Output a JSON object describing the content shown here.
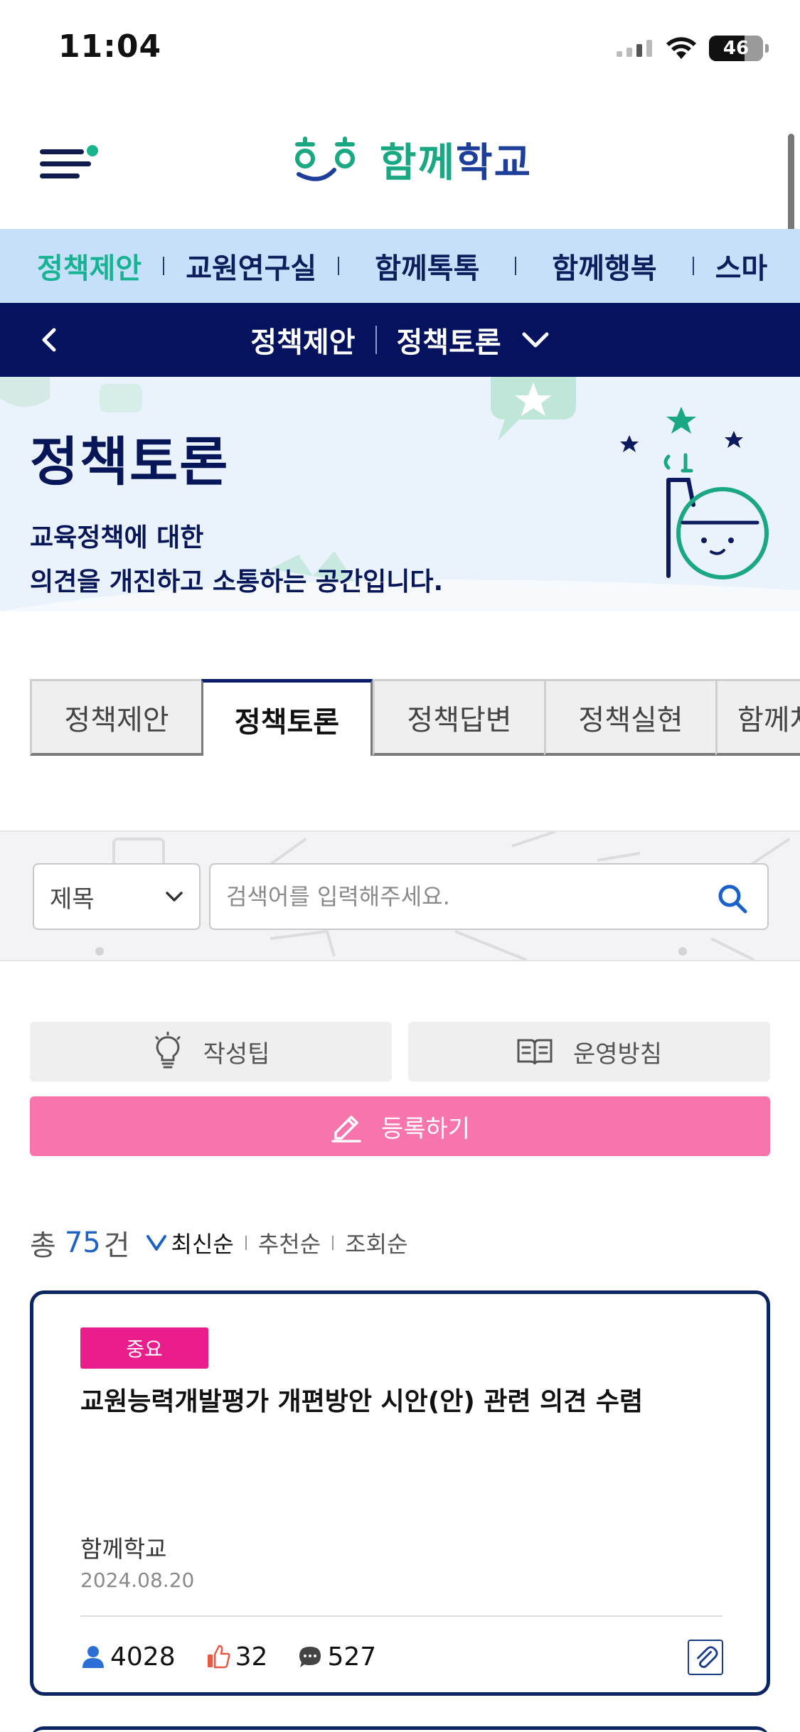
{
  "status_bar": {
    "time": "11:04",
    "battery": "46"
  },
  "header": {
    "logo_text_green": "함께",
    "logo_text_blue": "학교",
    "colors": {
      "navy": "#05135f",
      "green": "#18b393",
      "pink": "#f774ad",
      "magenta": "#e91e8c"
    }
  },
  "category_nav": {
    "items": [
      {
        "label": "정책제안",
        "active": true
      },
      {
        "label": "교원연구실",
        "active": false
      },
      {
        "label": "함께톡톡",
        "active": false
      },
      {
        "label": "함께행복",
        "active": false
      },
      {
        "label": "스마",
        "active": false
      }
    ]
  },
  "sub_nav": {
    "parent": "정책제안",
    "current": "정책토론"
  },
  "hero": {
    "title": "정책토론",
    "desc_line1": "교육정책에 대한",
    "desc_line2": "의견을 개진하고 소통하는 공간입니다."
  },
  "tabs": [
    {
      "label": "정책제안",
      "active": false
    },
    {
      "label": "정책토론",
      "active": true
    },
    {
      "label": "정책답변",
      "active": false
    },
    {
      "label": "정책실현",
      "active": false
    },
    {
      "label": "함께차",
      "active": false
    }
  ],
  "search": {
    "select_value": "제목",
    "placeholder": "검색어를 입력해주세요."
  },
  "buttons": {
    "tip": "작성팁",
    "policy": "운영방침",
    "register": "등록하기"
  },
  "list": {
    "total_label": "총",
    "total_count": "75",
    "total_unit": "건",
    "sort": [
      {
        "label": "최신순",
        "active": true
      },
      {
        "label": "추천순",
        "active": false
      },
      {
        "label": "조회순",
        "active": false
      }
    ]
  },
  "posts": [
    {
      "badge": "중요",
      "title": "교원능력개발평가 개편방안 시안(안) 관련 의견 수렴",
      "author": "함께학교",
      "date": "2024.08.20",
      "views": "4028",
      "likes": "32",
      "comments": "527"
    }
  ]
}
